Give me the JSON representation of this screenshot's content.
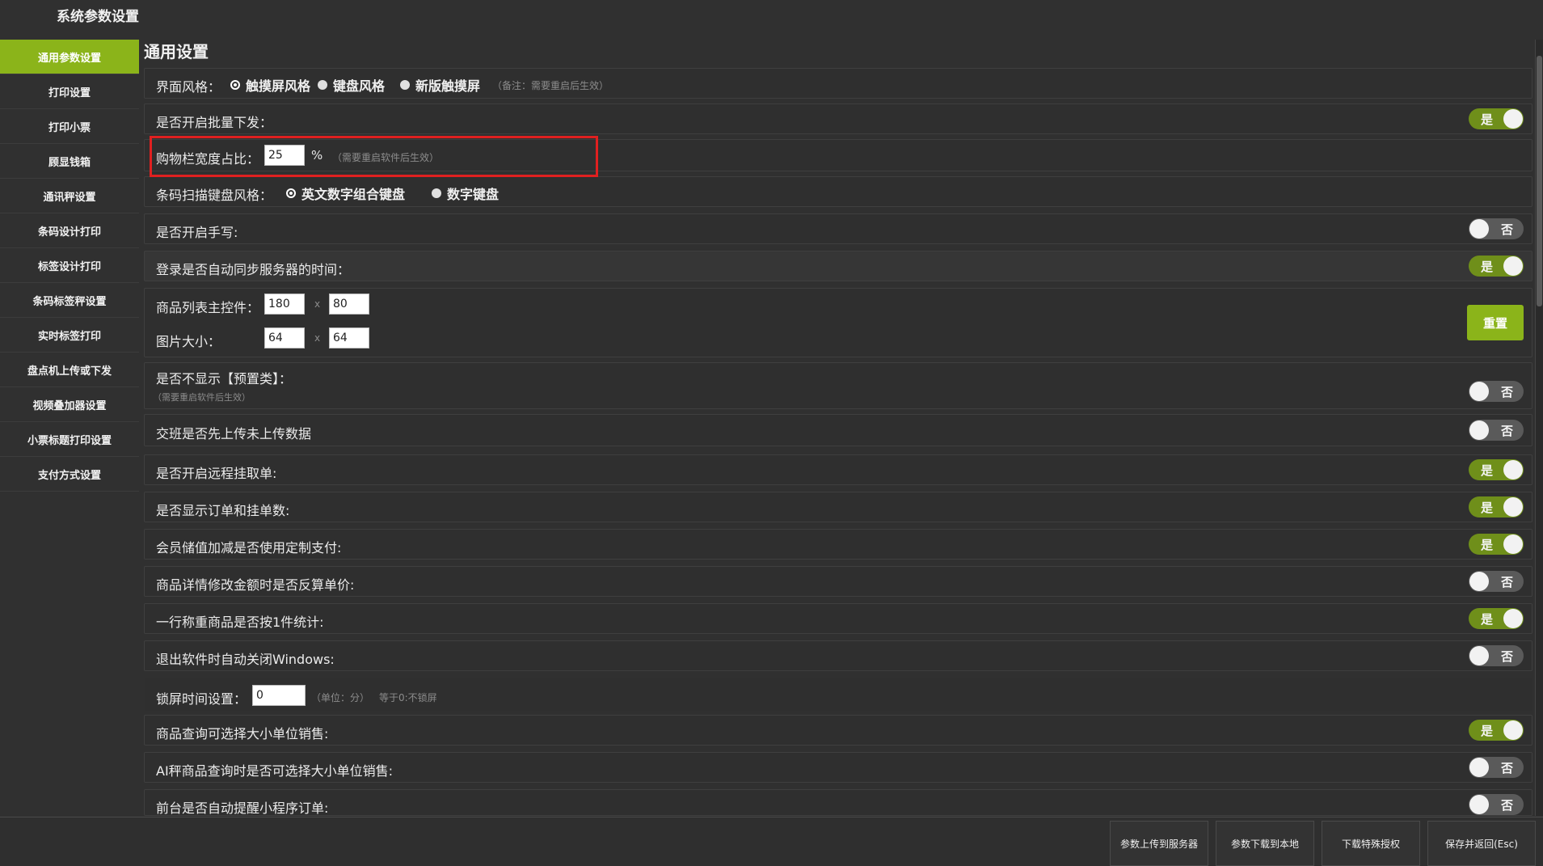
{
  "window": {
    "title": "系统参数设置"
  },
  "sidebar": {
    "items": [
      {
        "label": "通用参数设置",
        "active": true
      },
      {
        "label": "打印设置",
        "active": false
      },
      {
        "label": "打印小票",
        "active": false
      },
      {
        "label": "顾显钱箱",
        "active": false
      },
      {
        "label": "通讯秤设置",
        "active": false
      },
      {
        "label": "条码设计打印",
        "active": false
      },
      {
        "label": "标签设计打印",
        "active": false
      },
      {
        "label": "条码标签秤设置",
        "active": false
      },
      {
        "label": "实时标签打印",
        "active": false
      },
      {
        "label": "盘点机上传或下发",
        "active": false
      },
      {
        "label": "视频叠加器设置",
        "active": false
      },
      {
        "label": "小票标题打印设置",
        "active": false
      },
      {
        "label": "支付方式设置",
        "active": false
      }
    ]
  },
  "main": {
    "section_title": "通用设置",
    "ui_style": {
      "label": "界面风格：",
      "options": [
        {
          "label": "触摸屏风格",
          "selected": true
        },
        {
          "label": "键盘风格",
          "selected": false
        },
        {
          "label": "新版触摸屏",
          "selected": false
        }
      ],
      "note": "（备注：需要重启后生效）"
    },
    "batch_send": {
      "label": "是否开启批量下发：",
      "toggle": "是",
      "on": true
    },
    "cart_width": {
      "label": "购物栏宽度占比：",
      "value": "25",
      "unit": "%",
      "note": "（需要重启软件后生效）"
    },
    "barcode_keyboard": {
      "label": "条码扫描键盘风格：",
      "options": [
        {
          "label": "英文数字组合键盘",
          "selected": true
        },
        {
          "label": "数字键盘",
          "selected": false
        }
      ]
    },
    "handwriting": {
      "label": "是否开启手写:",
      "toggle": "否",
      "on": false
    },
    "sync_time": {
      "label": "登录是否自动同步服务器的时间：",
      "toggle": "是",
      "on": true
    },
    "list_control": {
      "label": "商品列表主控件：",
      "w": "180",
      "h": "80",
      "x": "x",
      "img_label": "图片大小：",
      "img_w": "64",
      "img_h": "64",
      "reset_label": "重置"
    },
    "hide_preset": {
      "label": "是否不显示【预置类】：",
      "note": "（需要重启软件后生效）",
      "toggle": "否",
      "on": false
    },
    "upload_before_shift": {
      "label": "交班是否先上传未上传数据",
      "toggle": "否",
      "on": false
    },
    "remote_hold": {
      "label": "是否开启远程挂取单:",
      "toggle": "是",
      "on": true
    },
    "show_order_count": {
      "label": "是否显示订单和挂单数:",
      "toggle": "是",
      "on": true
    },
    "member_custom_pay": {
      "label": "会员储值加减是否使用定制支付:",
      "toggle": "是",
      "on": true
    },
    "reverse_price": {
      "label": "商品详情修改金额时是否反算单价:",
      "toggle": "否",
      "on": false
    },
    "weigh_one": {
      "label": "一行称重商品是否按1件统计:",
      "toggle": "是",
      "on": true
    },
    "close_windows": {
      "label": "退出软件时自动关闭Windows:",
      "toggle": "否",
      "on": false
    },
    "lock_screen": {
      "label": "锁屏时间设置：",
      "value": "0",
      "unit": "（单位：分）",
      "note": "等于0:不锁屏"
    },
    "unit_sale": {
      "label": "商品查询可选择大小单位销售:",
      "toggle": "是",
      "on": true
    },
    "ai_unit_sale": {
      "label": "AI秤商品查询时是否可选择大小单位销售:",
      "toggle": "否",
      "on": false
    },
    "mini_program": {
      "label": "前台是否自动提醒小程序订单:",
      "toggle": "否",
      "on": false
    }
  },
  "footer": {
    "buttons": [
      "参数上传到服务器",
      "参数下载到本地",
      "下载特殊授权",
      "保存并返回(Esc)"
    ]
  },
  "colors": {
    "accent": "#8bb41a",
    "toggle_on": "#6f8f1a",
    "highlight": "#e02020",
    "background": "#303030"
  }
}
